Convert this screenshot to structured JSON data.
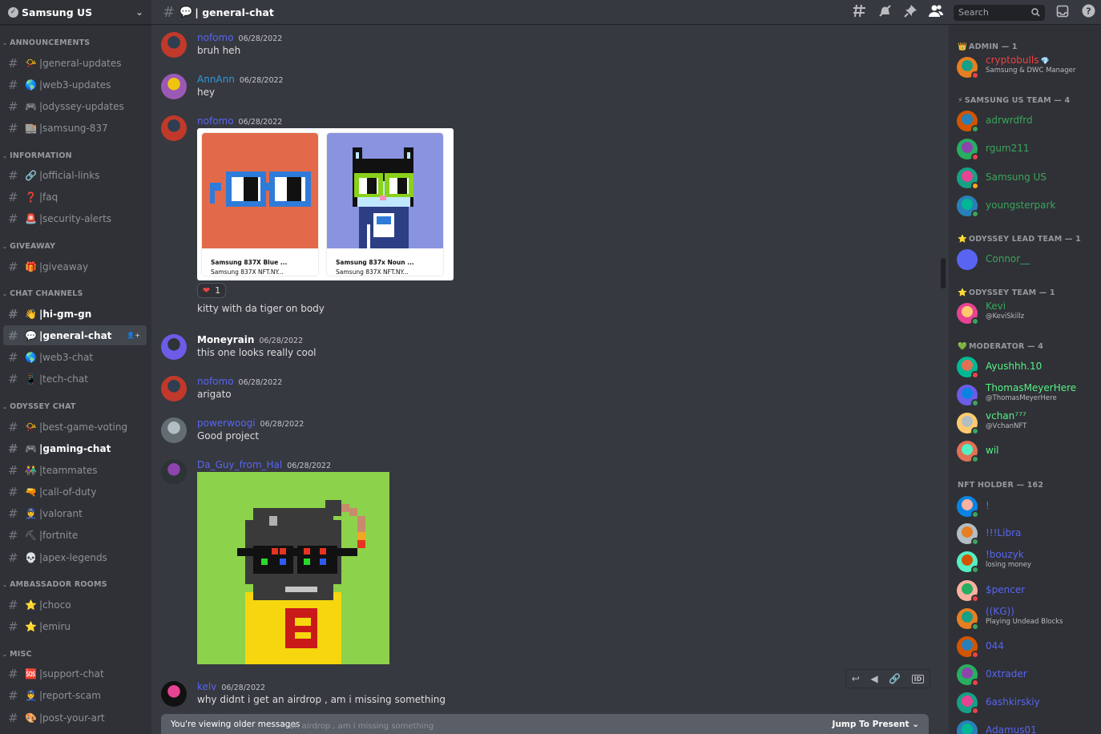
{
  "server": {
    "name": "Samsung US"
  },
  "sidebar": {
    "categories": [
      {
        "label": "ANNOUNCEMENTS",
        "channels": [
          {
            "name": "general-updates",
            "emoji": "📯"
          },
          {
            "name": "web3-updates",
            "emoji": "🌎"
          },
          {
            "name": "odyssey-updates",
            "emoji": "🎮"
          },
          {
            "name": "samsung-837",
            "emoji": "🏬"
          }
        ]
      },
      {
        "label": "INFORMATION",
        "channels": [
          {
            "name": "official-links",
            "emoji": "🔗"
          },
          {
            "name": "faq",
            "emoji": "❓"
          },
          {
            "name": "security-alerts",
            "emoji": "🚨"
          }
        ]
      },
      {
        "label": "GIVEAWAY",
        "channels": [
          {
            "name": "giveaway",
            "emoji": "🎁"
          }
        ]
      },
      {
        "label": "CHAT CHANNELS",
        "channels": [
          {
            "name": "hi-gm-gn",
            "emoji": "👋"
          },
          {
            "name": "general-chat",
            "emoji": "💬"
          },
          {
            "name": "web3-chat",
            "emoji": "🌎"
          },
          {
            "name": "tech-chat",
            "emoji": "📱"
          }
        ]
      },
      {
        "label": "ODYSSEY CHAT",
        "channels": [
          {
            "name": "best-game-voting",
            "emoji": "📯"
          },
          {
            "name": "gaming-chat",
            "emoji": "🎮"
          },
          {
            "name": "teammates",
            "emoji": "👫"
          },
          {
            "name": "call-of-duty",
            "emoji": "🔫"
          },
          {
            "name": "valorant",
            "emoji": "👮"
          },
          {
            "name": "fortnite",
            "emoji": "⛏"
          },
          {
            "name": "apex-legends",
            "emoji": "💀"
          }
        ]
      },
      {
        "label": "AMBASSADOR ROOMS",
        "channels": [
          {
            "name": "choco",
            "emoji": "⭐"
          },
          {
            "name": "emiru",
            "emoji": "⭐"
          }
        ]
      },
      {
        "label": "MISC",
        "channels": [
          {
            "name": "support-chat",
            "emoji": "🆘"
          },
          {
            "name": "report-scam",
            "emoji": "👮"
          },
          {
            "name": "post-your-art",
            "emoji": "🎨"
          }
        ]
      }
    ],
    "active_channel": "general-chat"
  },
  "header": {
    "channel_emoji": "💬",
    "channel": "| general-chat",
    "search_placeholder": "Search"
  },
  "messages": [
    {
      "user": "nofomo",
      "color": "#5865f2",
      "time": "06/28/2022",
      "text": "bruh heh"
    },
    {
      "user": "AnnAnn",
      "color": "#3498db",
      "time": "06/28/2022",
      "text": "hey"
    },
    {
      "user": "nofomo",
      "color": "#5865f2",
      "time": "06/28/2022",
      "text": "kitty with da tiger on body",
      "embed": [
        {
          "title": "Samsung 837X Blue ...",
          "sub": "Samsung 837X NFT.NY..."
        },
        {
          "title": "Samsung 837x Noun ...",
          "sub": "Samsung 837X NFT.NY..."
        }
      ],
      "reaction": {
        "emoji": "❤",
        "count": "1"
      }
    },
    {
      "user": "Moneyrain",
      "color": "#ffffff",
      "time": "06/28/2022",
      "text": "this one looks really cool"
    },
    {
      "user": "nofomo",
      "color": "#5865f2",
      "time": "06/28/2022",
      "text": "arigato"
    },
    {
      "user": "powerwoogi",
      "color": "#5865f2",
      "time": "06/28/2022",
      "text": "Good project"
    },
    {
      "user": "Da_Guy_from_Hal",
      "color": "#5865f2",
      "time": "06/28/2022",
      "text": ""
    },
    {
      "user": "kelv",
      "color": "#5865f2",
      "time": "06/28/2022",
      "text": "why didnt i get an airdrop , am i missing something"
    }
  ],
  "older_banner": {
    "text": "You're viewing older messages",
    "jump": "Jump To Present ⌄",
    "ghost": "an airdrop , am i missing something"
  },
  "members": {
    "groups": [
      {
        "label": "ADMIN — 1",
        "icon": "👑",
        "members": [
          {
            "name": "cryptobulls",
            "color": "#ed4245",
            "sub": "Samsung & DWC Manager",
            "status": "dnd",
            "badge": "💎"
          }
        ]
      },
      {
        "label": "SAMSUNG US TEAM — 4",
        "icon": "⚡",
        "members": [
          {
            "name": "adrwrdfrd",
            "color": "#3ba55c",
            "sub": "",
            "status": "online"
          },
          {
            "name": "rgum211",
            "color": "#3ba55c",
            "sub": "",
            "status": "dnd"
          },
          {
            "name": "Samsung US",
            "color": "#3ba55c",
            "sub": "",
            "status": "idle"
          },
          {
            "name": "youngsterpark",
            "color": "#3ba55c",
            "sub": "",
            "status": "online"
          }
        ]
      },
      {
        "label": "ODYSSEY LEAD TEAM — 1",
        "icon": "⭐",
        "members": [
          {
            "name": "Connor__",
            "color": "#3ba55c",
            "sub": "",
            "status": "none"
          }
        ]
      },
      {
        "label": "ODYSSEY TEAM — 1",
        "icon": "⭐",
        "members": [
          {
            "name": "Kevi",
            "color": "#3ba55c",
            "sub": "@KeviSkillz",
            "status": "online"
          }
        ]
      },
      {
        "label": "MODERATOR — 4",
        "icon": "💚",
        "members": [
          {
            "name": "Ayushhh.10",
            "color": "#57f287",
            "sub": "",
            "status": "dnd"
          },
          {
            "name": "ThomasMeyerHere",
            "color": "#57f287",
            "sub": "@ThomasMeyerHere",
            "status": "online"
          },
          {
            "name": "vchan⁷⁷⁷",
            "color": "#57f287",
            "sub": "@VchanNFT",
            "status": "online"
          },
          {
            "name": "wil",
            "color": "#57f287",
            "sub": "",
            "status": "online"
          }
        ]
      },
      {
        "label": "NFT HOLDER — 162",
        "icon": "",
        "members": [
          {
            "name": "!",
            "color": "#5865f2",
            "sub": "",
            "status": "online"
          },
          {
            "name": "!!!Libra",
            "color": "#5865f2",
            "sub": "",
            "status": "online"
          },
          {
            "name": "!bouzyk",
            "color": "#5865f2",
            "sub": "losing money",
            "status": "online"
          },
          {
            "name": "$pencer",
            "color": "#5865f2",
            "sub": "",
            "status": "dnd"
          },
          {
            "name": "((KG))",
            "color": "#5865f2",
            "sub": "Playing Undead Blocks",
            "status": "online"
          },
          {
            "name": "044",
            "color": "#5865f2",
            "sub": "",
            "status": "dnd"
          },
          {
            "name": "0xtrader",
            "color": "#5865f2",
            "sub": "",
            "status": "dnd"
          },
          {
            "name": "6ashkirskiy",
            "color": "#5865f2",
            "sub": "",
            "status": "dnd"
          },
          {
            "name": "Adamus01",
            "color": "#5865f2",
            "sub": "",
            "status": "dnd"
          }
        ]
      }
    ]
  },
  "colors": {
    "online": "#3ba55c",
    "dnd": "#ed4245",
    "idle": "#faa61a",
    "none": "transparent"
  }
}
